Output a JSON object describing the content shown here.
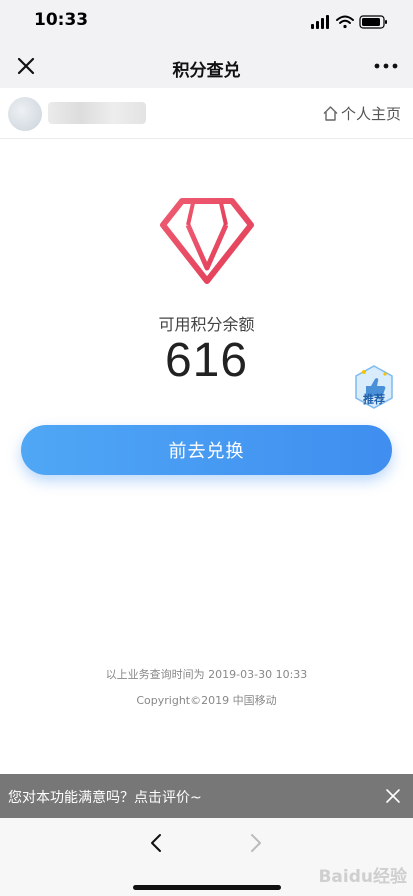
{
  "status_bar": {
    "time": "10:33"
  },
  "nav": {
    "title": "积分查兑"
  },
  "profile": {
    "home_link_label": "个人主页"
  },
  "balance": {
    "label": "可用积分余额",
    "value": "616"
  },
  "recommend": {
    "label": "推荐"
  },
  "actions": {
    "exchange_label": "前去兑换"
  },
  "footer": {
    "query_time": "以上业务查询时间为 2019-03-30 10:33",
    "copyright": "Copyright©2019 中国移动"
  },
  "feedback": {
    "text": "您对本功能满意吗？点击评价~"
  },
  "watermark": {
    "text": "Baidu经验"
  },
  "colors": {
    "accent": "#3f8ef0",
    "diamond": "#e8475f",
    "feedback_bg": "#777777"
  },
  "icons": [
    "close-icon",
    "more-icon",
    "home-icon",
    "diamond-icon",
    "thumbs-up-icon",
    "back-icon",
    "forward-icon"
  ]
}
